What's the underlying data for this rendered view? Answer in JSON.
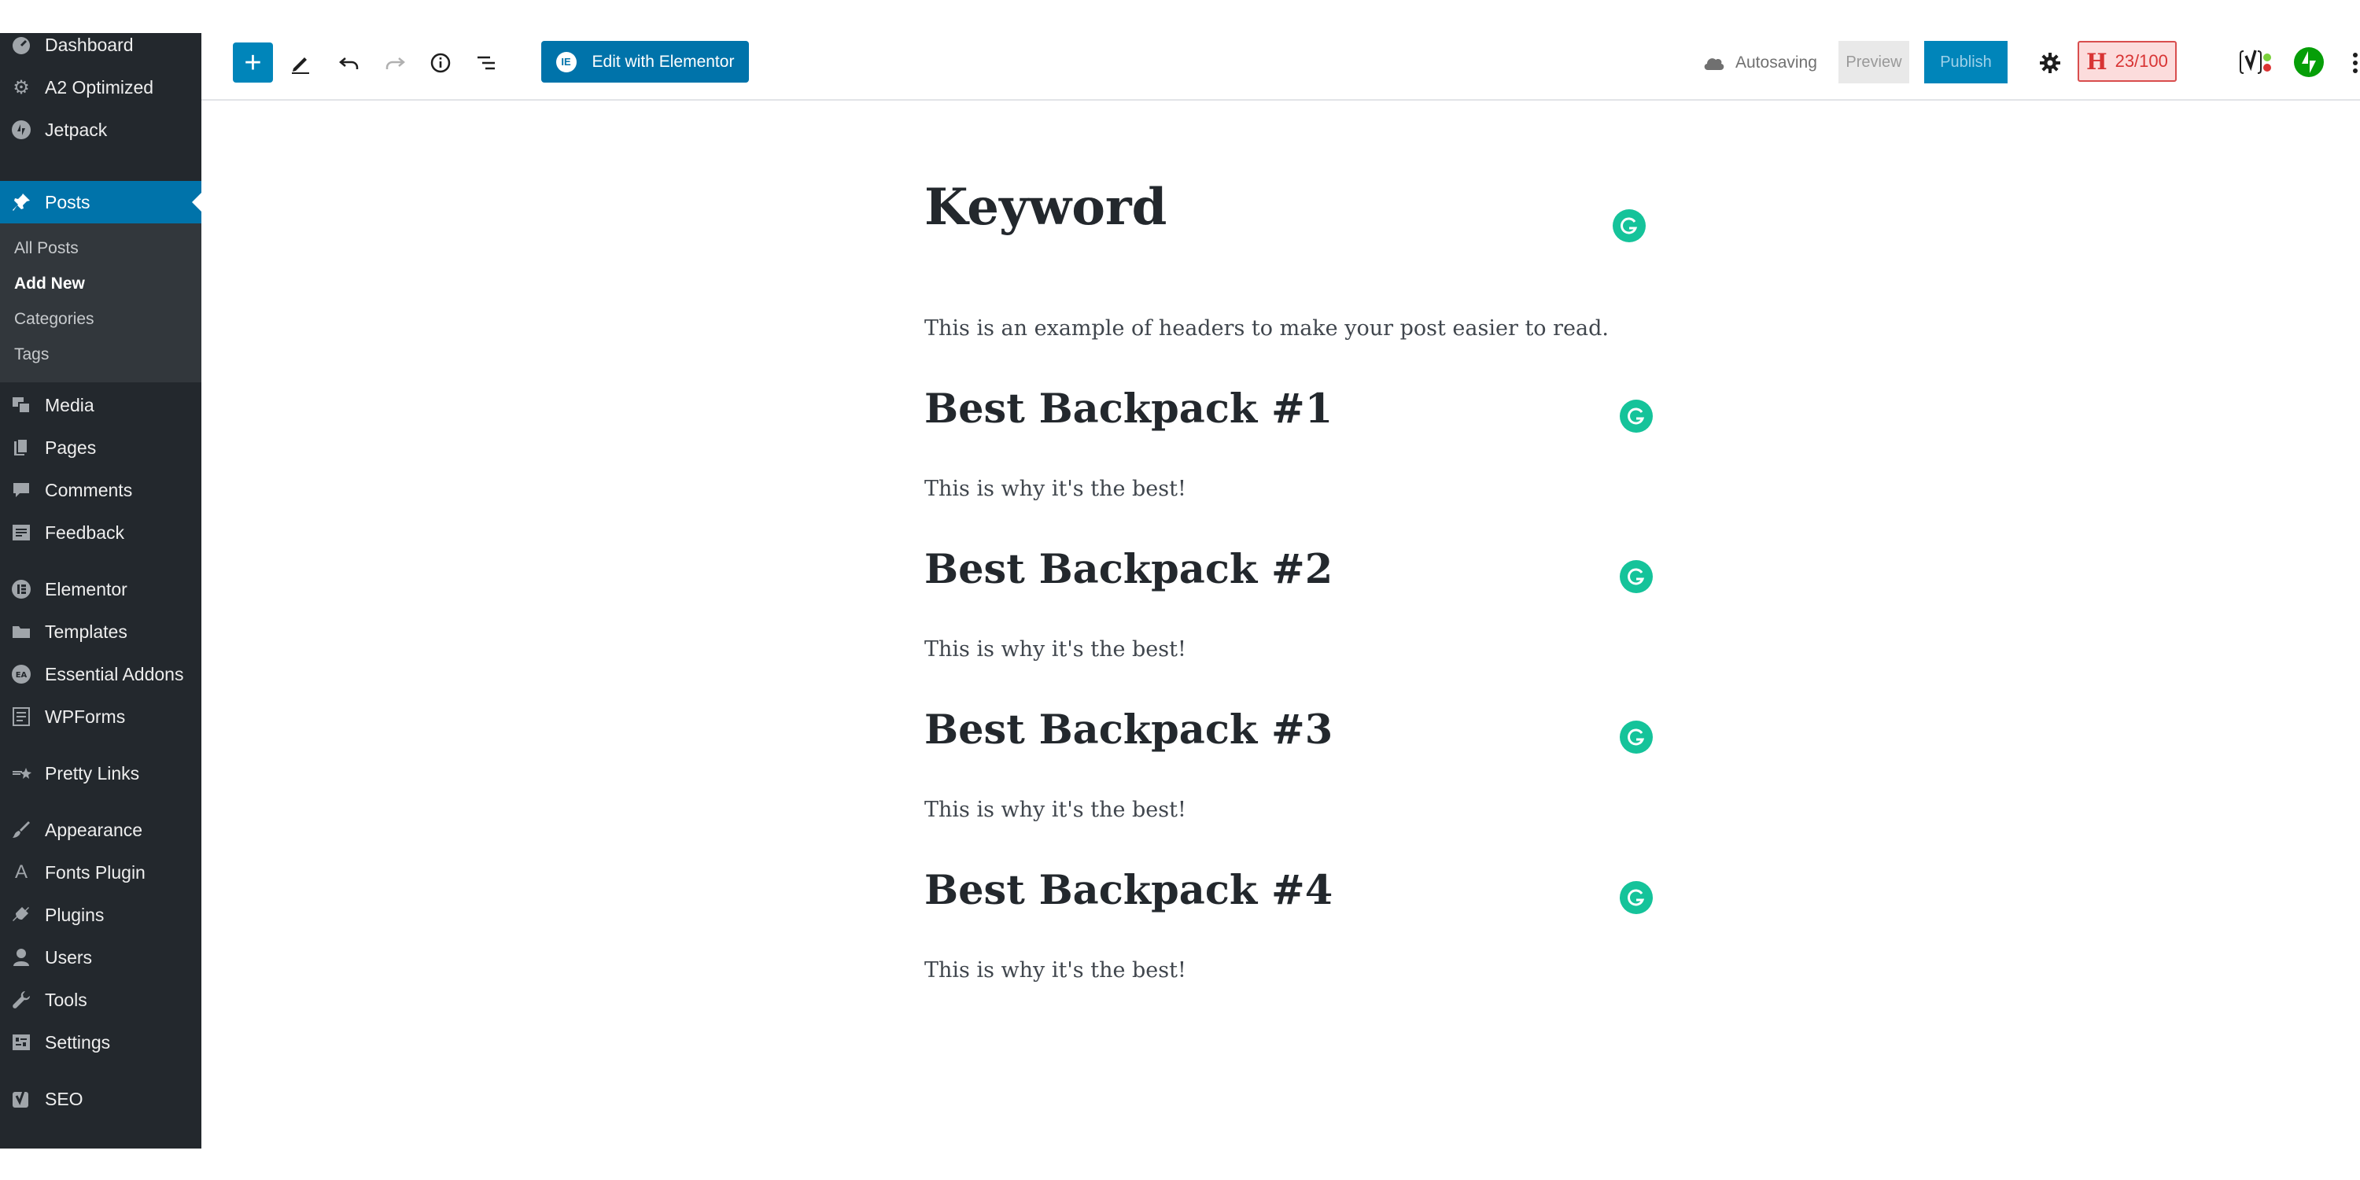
{
  "sidebar": {
    "top_items": [
      {
        "label": "Dashboard",
        "icon": "dashboard-icon"
      },
      {
        "label": "A2 Optimized",
        "icon": "gear-icon"
      },
      {
        "label": "Jetpack",
        "icon": "jetpack-icon"
      }
    ],
    "active_item": {
      "label": "Posts",
      "icon": "pushpin-icon"
    },
    "submenu": [
      {
        "label": "All Posts",
        "current": false
      },
      {
        "label": "Add New",
        "current": true
      },
      {
        "label": "Categories",
        "current": false
      },
      {
        "label": "Tags",
        "current": false
      }
    ],
    "items": [
      {
        "label": "Media",
        "icon": "media-icon"
      },
      {
        "label": "Pages",
        "icon": "pages-icon"
      },
      {
        "label": "Comments",
        "icon": "comments-icon"
      },
      {
        "label": "Feedback",
        "icon": "feedback-icon"
      },
      {
        "label": "Elementor",
        "icon": "elementor-icon"
      },
      {
        "label": "Templates",
        "icon": "folder-icon"
      },
      {
        "label": "Essential Addons",
        "icon": "essential-addons-icon"
      },
      {
        "label": "WPForms",
        "icon": "forms-icon"
      },
      {
        "label": "Pretty Links",
        "icon": "pretty-links-icon"
      },
      {
        "label": "Appearance",
        "icon": "paintbrush-icon"
      },
      {
        "label": "Fonts Plugin",
        "icon": "font-icon"
      },
      {
        "label": "Plugins",
        "icon": "plugin-icon"
      },
      {
        "label": "Users",
        "icon": "users-icon"
      },
      {
        "label": "Tools",
        "icon": "wrench-icon"
      },
      {
        "label": "Settings",
        "icon": "settings-icon"
      },
      {
        "label": "SEO",
        "icon": "yoast-icon"
      }
    ]
  },
  "toolbar": {
    "elementor_label": "Edit with Elementor",
    "autosave_label": "Autosaving",
    "preview_label": "Preview",
    "publish_label": "Publish",
    "score_label": "23/100",
    "score_letter": "H"
  },
  "post": {
    "title": "Keyword",
    "intro": "This is an example of headers to make your post easier to read.",
    "sections": [
      {
        "heading": "Best Backpack #1",
        "body": "This is why it's the best!"
      },
      {
        "heading": "Best Backpack #2",
        "body": "This is why it's the best!"
      },
      {
        "heading": "Best Backpack #3",
        "body": "This is why it's the best!"
      },
      {
        "heading": "Best Backpack #4",
        "body": "This is why it's the best!"
      }
    ]
  },
  "colors": {
    "sidebar_bg": "#23282d",
    "accent": "#0073aa",
    "grammarly": "#15c39a",
    "score_red": "#d83434"
  }
}
